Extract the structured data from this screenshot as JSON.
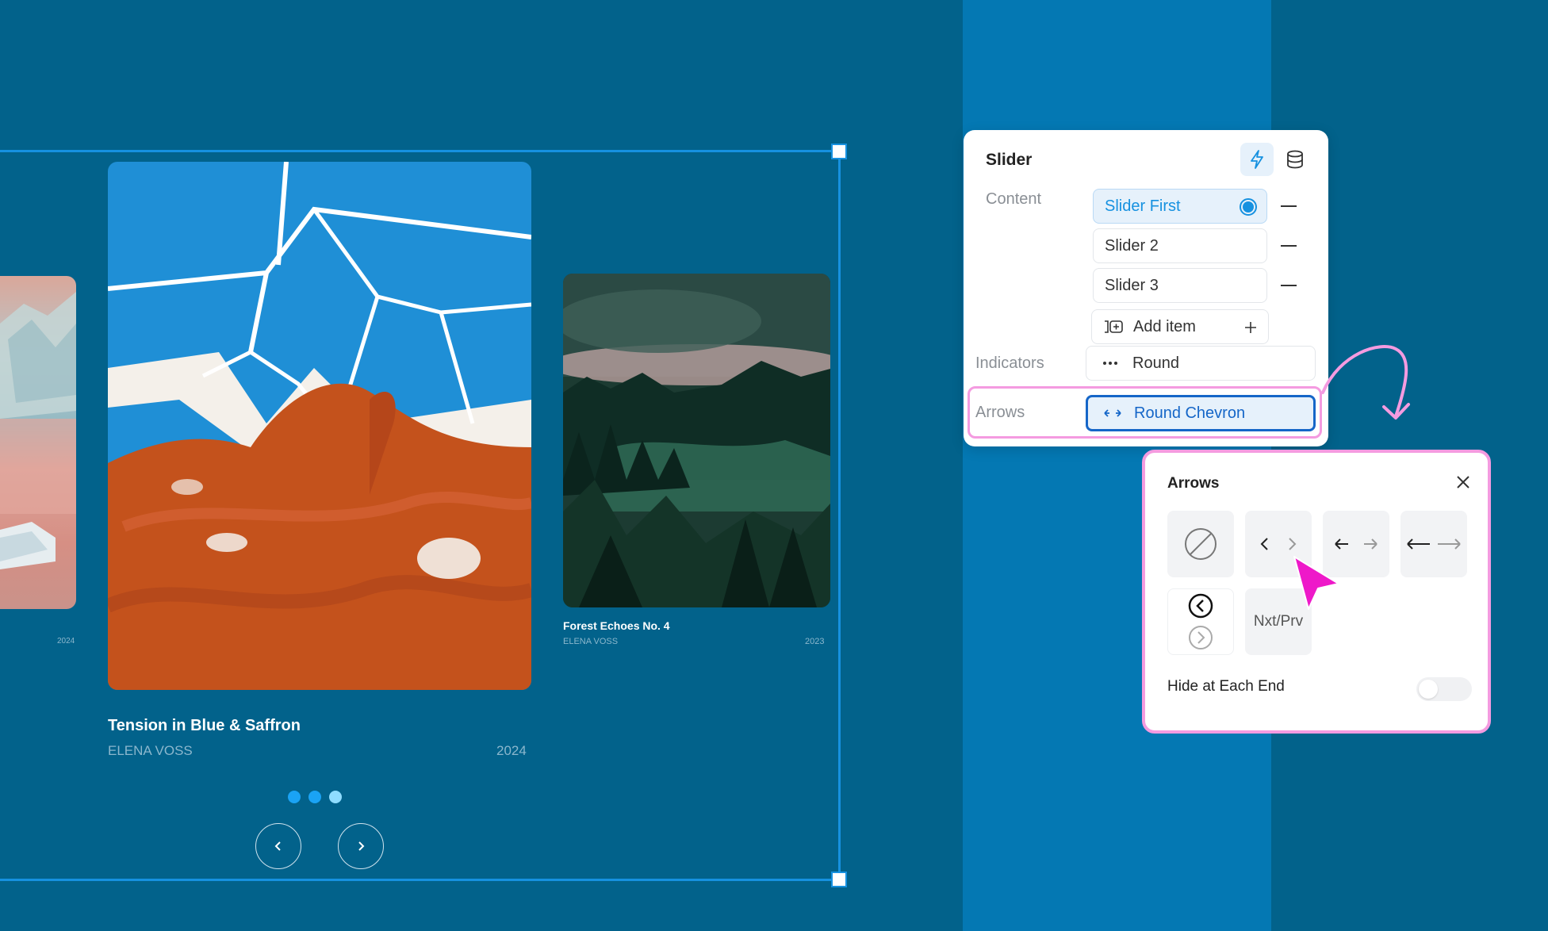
{
  "canvas": {
    "slides": [
      {
        "title": "",
        "artist": "",
        "year": "2024"
      },
      {
        "title": "Tension in Blue & Saffron",
        "artist": "ELENA VOSS",
        "year": "2024"
      },
      {
        "title": "Forest Echoes No. 4",
        "artist": "ELENA VOSS",
        "year": "2023"
      }
    ],
    "indicator_count": 3,
    "active_indicator": 3
  },
  "panel": {
    "title": "Slider",
    "content_label": "Content",
    "items": [
      {
        "label": "Slider First",
        "selected": true
      },
      {
        "label": "Slider 2",
        "selected": false
      },
      {
        "label": "Slider 3",
        "selected": false
      }
    ],
    "add_item_label": "Add item",
    "indicators_label": "Indicators",
    "indicators_value": "Round",
    "arrows_label": "Arrows",
    "arrows_value": "Round Chevron"
  },
  "popup": {
    "title": "Arrows",
    "options": [
      "none",
      "chevron",
      "short-arrow",
      "long-arrow",
      "round-chevron",
      "text"
    ],
    "text_option_label": "Nxt/Prv",
    "selected_option": "round-chevron",
    "hide_at_each_end_label": "Hide at Each End",
    "hide_at_each_end": false
  },
  "colors": {
    "canvas_bg": "#02628b",
    "accent": "#1691e0",
    "highlight": "#f49be0",
    "cursor": "#ee19c9"
  }
}
